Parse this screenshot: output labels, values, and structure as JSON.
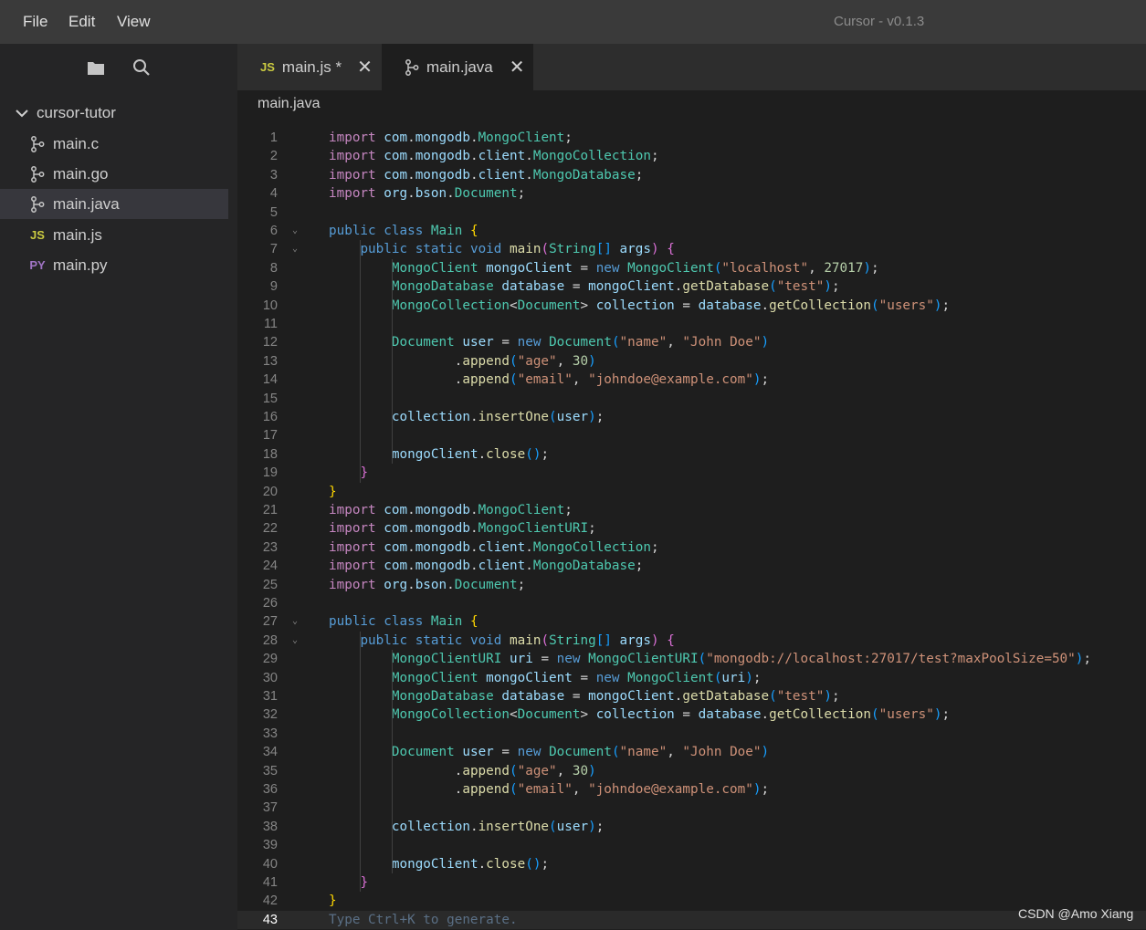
{
  "menu": {
    "file": "File",
    "edit": "Edit",
    "view": "View"
  },
  "app_title": "Cursor - v0.1.3",
  "sidebar": {
    "icons": {
      "explorer": "folder-icon",
      "search": "search-icon"
    },
    "folder": "cursor-tutor",
    "files": [
      {
        "label": "main.c",
        "icon": "git-branch-icon"
      },
      {
        "label": "main.go",
        "icon": "git-branch-icon"
      },
      {
        "label": "main.java",
        "icon": "git-branch-icon",
        "active": true
      },
      {
        "label": "main.js",
        "icon": "JS"
      },
      {
        "label": "main.py",
        "icon": "PY"
      }
    ]
  },
  "tabs": [
    {
      "label": "main.js *",
      "icon": "JS",
      "close": "✕"
    },
    {
      "label": "main.java",
      "icon": "git-branch-icon",
      "close": "✕",
      "active": true
    }
  ],
  "breadcrumb": "main.java",
  "editor": {
    "current_line": 43,
    "hint": "Type Ctrl+K to generate.",
    "lines": [
      "import com.mongodb.MongoClient;",
      "import com.mongodb.client.MongoCollection;",
      "import com.mongodb.client.MongoDatabase;",
      "import org.bson.Document;",
      "",
      "public class Main {",
      "    public static void main(String[] args) {",
      "        MongoClient mongoClient = new MongoClient(\"localhost\", 27017);",
      "        MongoDatabase database = mongoClient.getDatabase(\"test\");",
      "        MongoCollection<Document> collection = database.getCollection(\"users\");",
      "",
      "        Document user = new Document(\"name\", \"John Doe\")",
      "                .append(\"age\", 30)",
      "                .append(\"email\", \"johndoe@example.com\");",
      "",
      "        collection.insertOne(user);",
      "",
      "        mongoClient.close();",
      "    }",
      "}",
      "import com.mongodb.MongoClient;",
      "import com.mongodb.MongoClientURI;",
      "import com.mongodb.client.MongoCollection;",
      "import com.mongodb.client.MongoDatabase;",
      "import org.bson.Document;",
      "",
      "public class Main {",
      "    public static void main(String[] args) {",
      "        MongoClientURI uri = new MongoClientURI(\"mongodb://localhost:27017/test?maxPoolSize=50\");",
      "        MongoClient mongoClient = new MongoClient(uri);",
      "        MongoDatabase database = mongoClient.getDatabase(\"test\");",
      "        MongoCollection<Document> collection = database.getCollection(\"users\");",
      "",
      "        Document user = new Document(\"name\", \"John Doe\")",
      "                .append(\"age\", 30)",
      "                .append(\"email\", \"johndoe@example.com\");",
      "",
      "        collection.insertOne(user);",
      "",
      "        mongoClient.close();",
      "    }",
      "}",
      ""
    ]
  },
  "watermark": "CSDN @Amo Xiang"
}
